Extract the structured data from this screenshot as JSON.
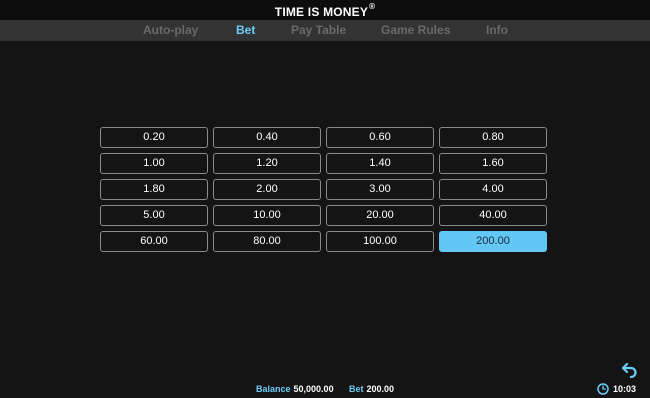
{
  "header": {
    "title": "TIME IS MONEY",
    "title_mark": "®"
  },
  "tabs": [
    {
      "label": "Auto-play",
      "active": false
    },
    {
      "label": "Bet",
      "active": true
    },
    {
      "label": "Pay Table",
      "active": false
    },
    {
      "label": "Game Rules",
      "active": false
    },
    {
      "label": "Info",
      "active": false
    }
  ],
  "bet_options": [
    "0.20",
    "0.40",
    "0.60",
    "0.80",
    "1.00",
    "1.20",
    "1.40",
    "1.60",
    "1.80",
    "2.00",
    "3.00",
    "4.00",
    "5.00",
    "10.00",
    "20.00",
    "40.00",
    "60.00",
    "80.00",
    "100.00",
    "200.00"
  ],
  "selected_bet": "200.00",
  "footer": {
    "balance_label": "Balance",
    "balance_value": "50,000.00",
    "bet_label": "Bet",
    "bet_value": "200.00",
    "time": "10:03"
  },
  "icons": {
    "back": "back-arrow-icon",
    "clock": "clock-icon"
  },
  "colors": {
    "accent": "#6ccdf7",
    "selected_fill": "#62c7f5",
    "background": "#141414",
    "tab_bar": "#333333"
  }
}
